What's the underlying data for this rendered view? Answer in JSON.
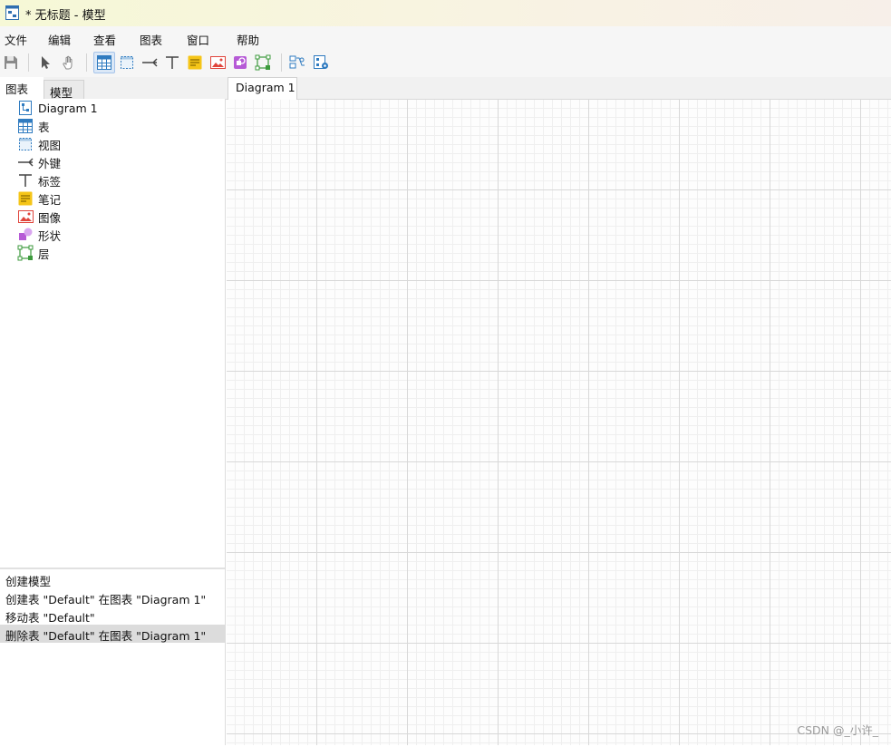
{
  "window": {
    "title": "* 无标题 - 模型"
  },
  "menu": {
    "file": "文件",
    "edit": "编辑",
    "view": "查看",
    "diagram": "图表",
    "window": "窗口",
    "help": "帮助"
  },
  "toolbar": {
    "tools": [
      "save-icon",
      "pointer-icon",
      "hand-icon",
      "table-icon",
      "view-icon",
      "foreign-key-icon",
      "label-icon",
      "note-icon",
      "image-icon",
      "shape-icon",
      "layer-icon",
      "align-icon",
      "diagram-settings-icon"
    ],
    "active_tool": "table-icon"
  },
  "tabs": {
    "diagrams": "图表",
    "model": "模型",
    "diagram_tab": "Diagram 1"
  },
  "tree": {
    "items": [
      {
        "label": "Diagram 1",
        "icon": "diagram-icon"
      },
      {
        "label": "表",
        "icon": "table-icon"
      },
      {
        "label": "视图",
        "icon": "view-icon"
      },
      {
        "label": "外键",
        "icon": "foreign-key-icon"
      },
      {
        "label": "标签",
        "icon": "label-icon"
      },
      {
        "label": "笔记",
        "icon": "note-icon"
      },
      {
        "label": "图像",
        "icon": "image-icon"
      },
      {
        "label": "形状",
        "icon": "shape-icon"
      },
      {
        "label": "层",
        "icon": "layer-icon"
      }
    ]
  },
  "history": {
    "items": [
      "创建模型",
      "创建表 \"Default\" 在图表 \"Diagram 1\"",
      "移动表 \"Default\"",
      "删除表 \"Default\" 在图表 \"Diagram 1\""
    ],
    "selected_index": 3
  },
  "watermark": "CSDN @_小许_",
  "colors": {
    "accent": "#2f7bc0",
    "note": "#f5c518",
    "image": "#e0453c",
    "shape": "#b65ad6",
    "layer": "#3c9a3c",
    "selection": "#dcdcdc"
  }
}
